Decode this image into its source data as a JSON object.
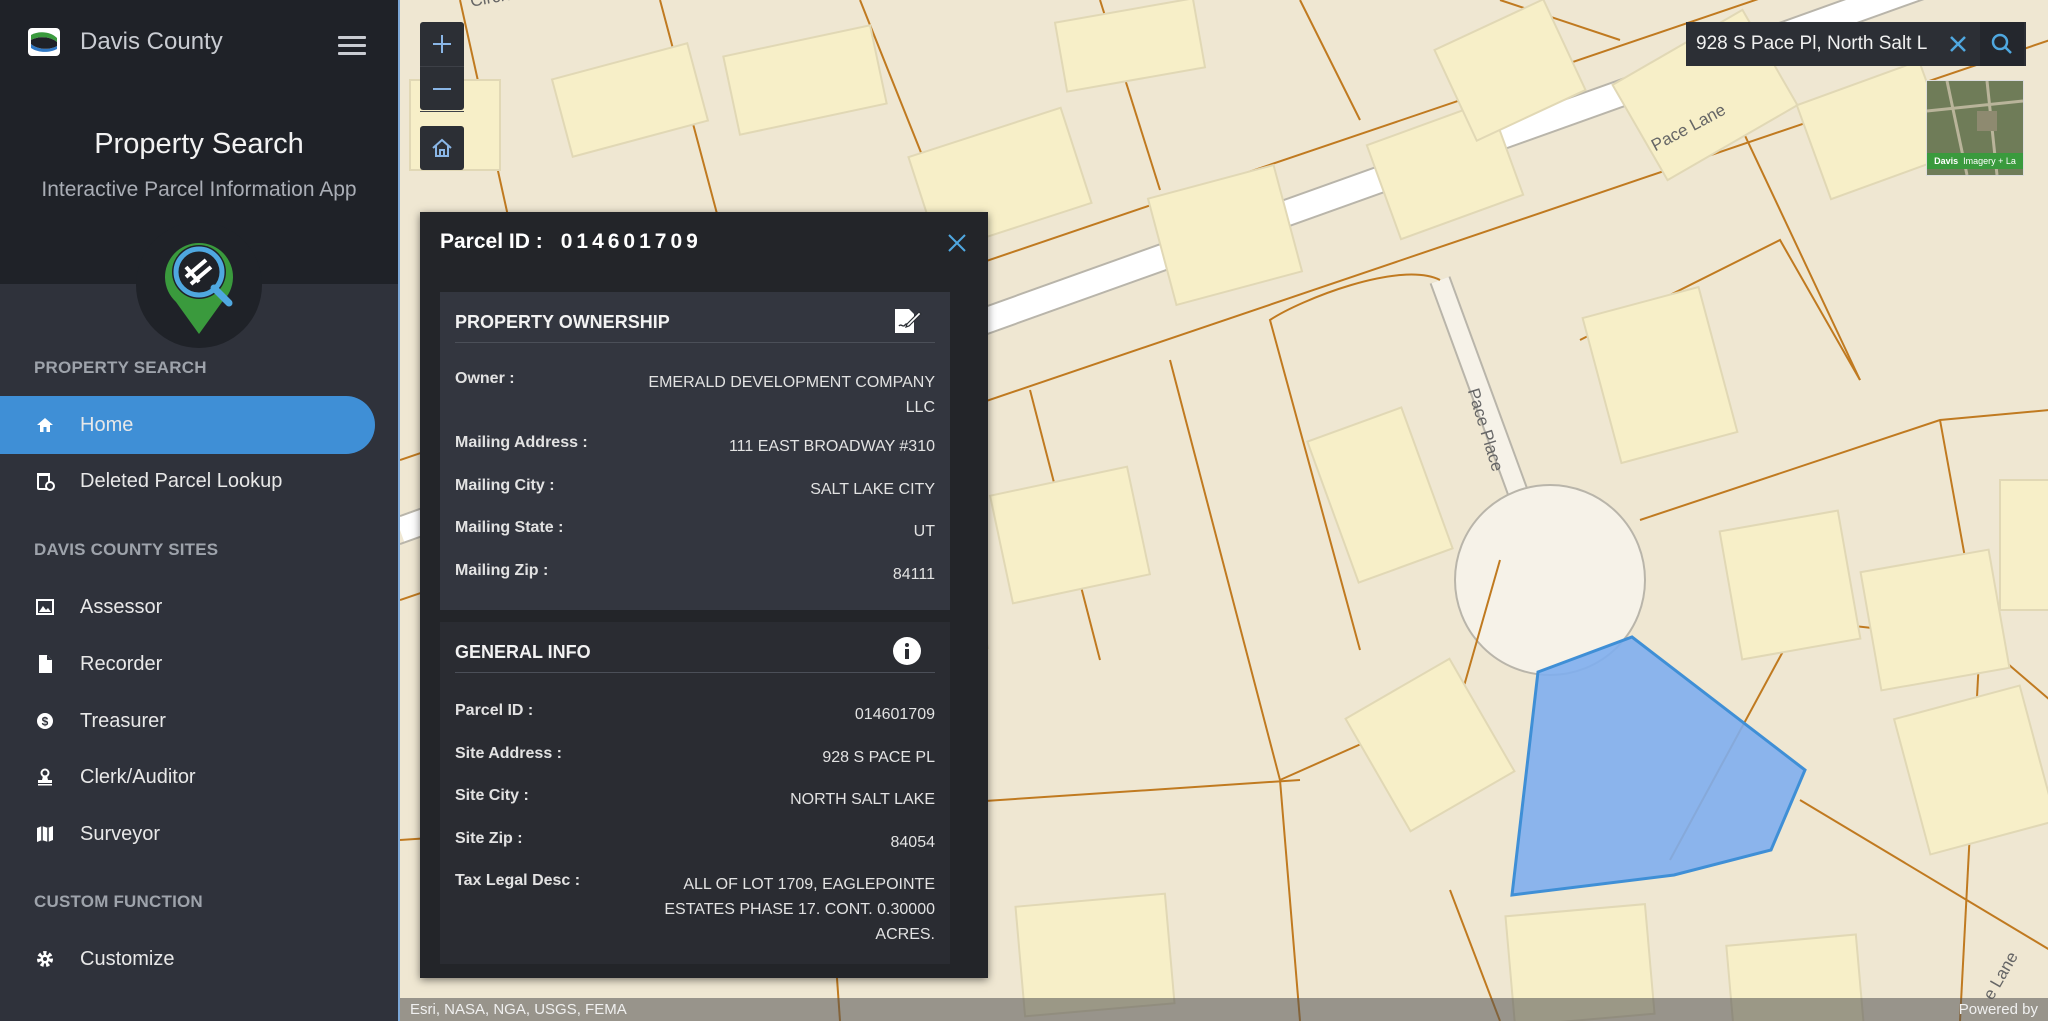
{
  "sidebar": {
    "brand_name": "Davis County",
    "app_title": "Property Search",
    "app_subtitle": "Interactive Parcel Information App",
    "section_property_search": "PROPERTY SEARCH",
    "section_sites": "DAVIS COUNTY SITES",
    "section_custom": "CUSTOM FUNCTION",
    "nav": [
      {
        "label": "Home",
        "icon": "home-icon",
        "active": true
      },
      {
        "label": "Deleted Parcel Lookup",
        "icon": "deleted-parcel-icon"
      },
      {
        "label": "Assessor",
        "icon": "image-icon"
      },
      {
        "label": "Recorder",
        "icon": "document-icon"
      },
      {
        "label": "Treasurer",
        "icon": "dollar-icon"
      },
      {
        "label": "Clerk/Auditor",
        "icon": "stamp-icon"
      },
      {
        "label": "Surveyor",
        "icon": "map-icon"
      },
      {
        "label": "Customize",
        "icon": "gear-icon"
      }
    ],
    "accent_color": "#3f8fd6"
  },
  "map": {
    "search_value": "928 S Pace Pl, North Salt L",
    "road_labels": {
      "pace_lane": "Pace Lane",
      "pace_place": "Pace Place",
      "circle": "Circle",
      "lane_bottom": "e Lane"
    },
    "overview_label": "Imagery + La",
    "overview_brand": "Davis",
    "attribution": "Esri, NASA, NGA, USGS, FEMA",
    "powered_by": "Powered by",
    "selected_parcel_color": "#7faeee"
  },
  "panel": {
    "header_label": "Parcel ID :",
    "header_value": "014601709",
    "ownership": {
      "title": "PROPERTY OWNERSHIP",
      "rows": [
        {
          "k": "Owner :",
          "v": "EMERALD DEVELOPMENT COMPANY LLC"
        },
        {
          "k": "Mailing Address :",
          "v": "111 EAST BROADWAY #310"
        },
        {
          "k": "Mailing City :",
          "v": "SALT LAKE CITY"
        },
        {
          "k": "Mailing State :",
          "v": "UT"
        },
        {
          "k": "Mailing Zip :",
          "v": "84111"
        }
      ]
    },
    "general": {
      "title": "GENERAL INFO",
      "rows": [
        {
          "k": "Parcel ID :",
          "v": "014601709"
        },
        {
          "k": "Site Address :",
          "v": "928 S PACE PL"
        },
        {
          "k": "Site City :",
          "v": "NORTH SALT LAKE"
        },
        {
          "k": "Site Zip :",
          "v": "84054"
        },
        {
          "k": "Tax Legal Desc :",
          "v": "ALL OF LOT 1709, EAGLEPOINTE ESTATES PHASE 17. CONT. 0.30000 ACRES."
        }
      ]
    }
  }
}
